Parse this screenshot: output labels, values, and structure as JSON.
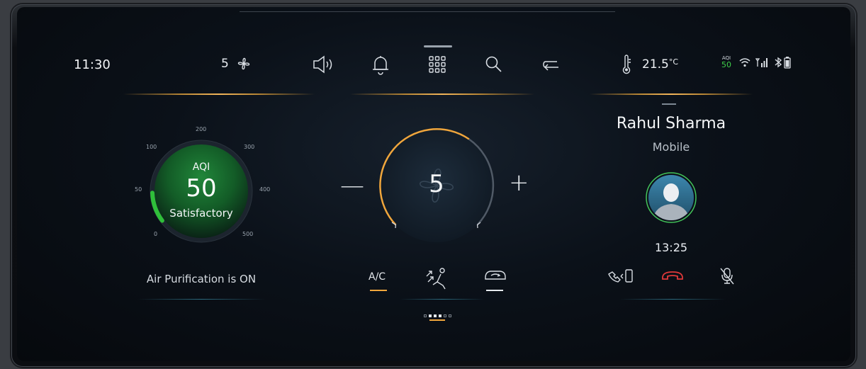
{
  "status_bar": {
    "time": "11:30",
    "fan_speed": "5",
    "temperature": "21.5",
    "temperature_unit": "°C",
    "aqi_label": "AQI",
    "aqi_value": "50",
    "icons": [
      "fan-icon",
      "volume-icon",
      "bell-icon",
      "apps-grid-icon",
      "search-icon",
      "back-icon",
      "thermometer-icon",
      "wifi-icon",
      "signal-icon",
      "bluetooth-icon",
      "battery-icon"
    ]
  },
  "aqi_panel": {
    "label": "AQI",
    "value": "50",
    "status": "Satisfactory",
    "scale_ticks": [
      "0",
      "50",
      "100",
      "200",
      "300",
      "400",
      "500"
    ],
    "caption": "Air Purification is ON",
    "value_fraction": 0.1,
    "color": "#2fbf3a"
  },
  "climate_panel": {
    "fan_value": "5",
    "minus_label": "—",
    "plus_label": "+",
    "modes": [
      {
        "label": "A/C",
        "active": true
      },
      {
        "label": "",
        "icon": "seat-airflow-icon",
        "active": false
      },
      {
        "label": "",
        "icon": "recirculation-icon",
        "active": false
      }
    ],
    "accent": "#f0a63c",
    "page_count": 6,
    "active_page": 2
  },
  "call_panel": {
    "caller_name": "Rahul Sharma",
    "caller_type": "Mobile",
    "duration": "13:25",
    "actions": [
      "transfer-to-phone-icon",
      "end-call-icon",
      "mute-mic-icon"
    ]
  }
}
